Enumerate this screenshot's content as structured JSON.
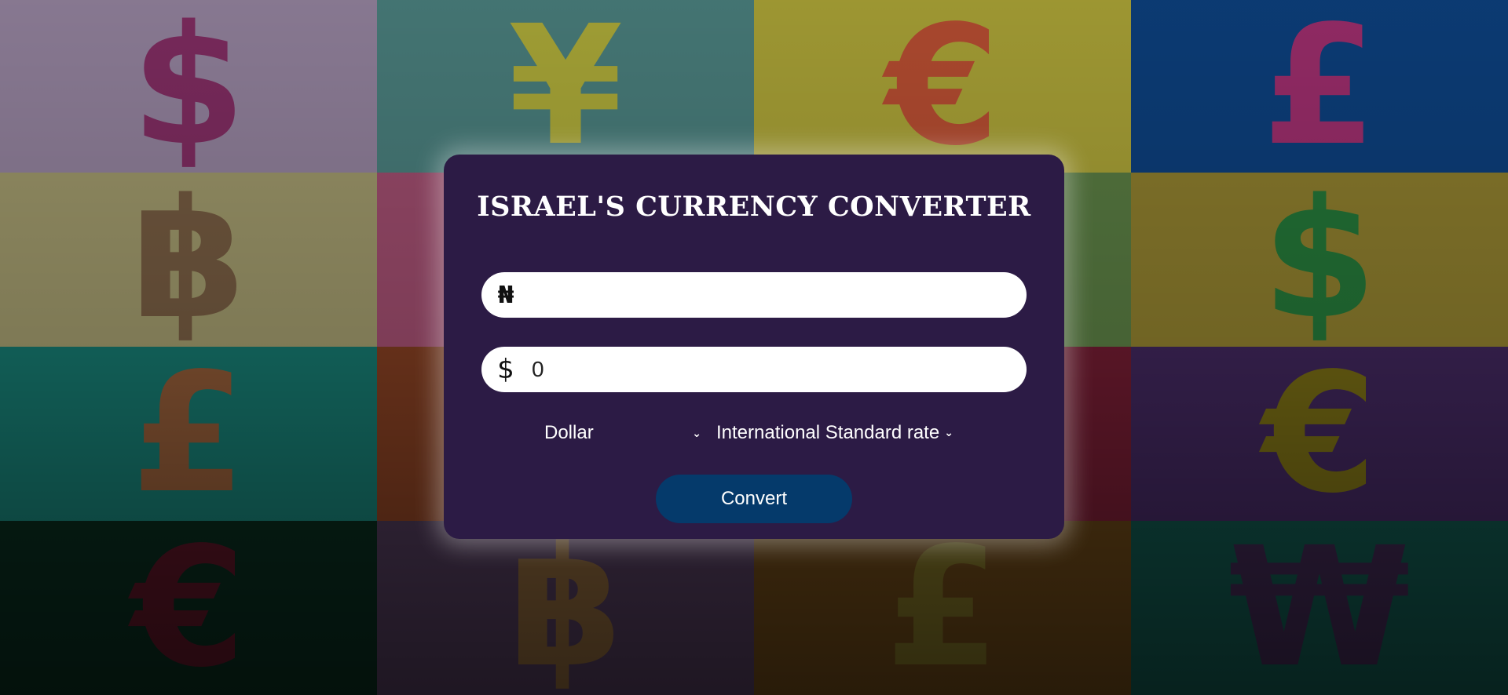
{
  "app": {
    "title": "ISRAEL'S CURRENCY CONVERTER"
  },
  "background": {
    "tiles": [
      {
        "symbol": "$",
        "bg": "#8e7e98",
        "fg": "#7a1d55"
      },
      {
        "symbol": "¥",
        "bg": "#477a78",
        "fg": "#b8ad2c"
      },
      {
        "symbol": "€",
        "bg": "#a59e35",
        "fg": "#b43d30"
      },
      {
        "symbol": "£",
        "bg": "#0c3d78",
        "fg": "#b02a66"
      },
      {
        "symbol": "฿",
        "bg": "#9a9468",
        "fg": "#6a4e38"
      },
      {
        "symbol": "¥",
        "bg": "#994a6a",
        "fg": "#a8863b"
      },
      {
        "symbol": "₣",
        "bg": "#567840",
        "fg": "#6a3a5f"
      },
      {
        "symbol": "$",
        "bg": "#897a2c",
        "fg": "#127138"
      },
      {
        "symbol": "£",
        "bg": "#157168",
        "fg": "#9a4f2a"
      },
      {
        "symbol": "₩",
        "bg": "#7a3a1f",
        "fg": "#6a2e16"
      },
      {
        "symbol": "€",
        "bg": "#6a1a2e",
        "fg": "#5a1726"
      },
      {
        "symbol": "€",
        "bg": "#3c2456",
        "fg": "#7a7108"
      },
      {
        "symbol": "€",
        "bg": "#08261a",
        "fg": "#5a0f22"
      },
      {
        "symbol": "฿",
        "bg": "#44324c",
        "fg": "#7c5a2c"
      },
      {
        "symbol": "£",
        "bg": "#5a3c14",
        "fg": "#6c6422"
      },
      {
        "symbol": "₩",
        "bg": "#0f4a42",
        "fg": "#3c1c45"
      }
    ]
  },
  "form": {
    "naira_symbol": "₦",
    "naira_value": "",
    "dollar_symbol": "$",
    "dollar_value": "0",
    "currency_select": "Dollar",
    "rate_select": "International Standard rate",
    "chevron_icon": "chevron-down-icon",
    "convert_label": "Convert"
  },
  "colors": {
    "card": "#2c1b45",
    "button": "#053a6b",
    "title": "#ffffff"
  }
}
